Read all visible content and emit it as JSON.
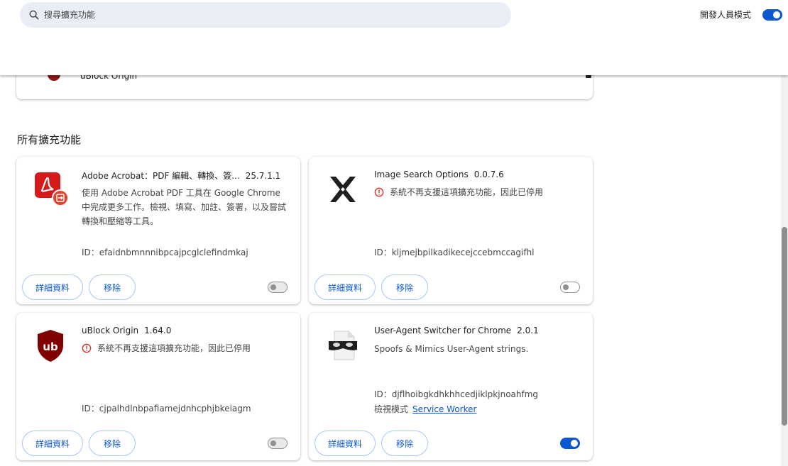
{
  "search": {
    "placeholder": "搜尋擴充功能"
  },
  "devmode": {
    "label": "開發人員模式",
    "enabled": true
  },
  "pinned": {
    "name": "uBlock Origin"
  },
  "section": {
    "title": "所有擴充功能"
  },
  "buttons": {
    "details": "詳細資料",
    "remove": "移除"
  },
  "extensions": [
    {
      "name": "Adobe Acrobat：PDF 編輯、轉換、簽...",
      "version": "25.7.1.1",
      "description": "使用 Adobe Acrobat PDF 工具在 Google Chrome 中完成更多工作。檢視、填寫、加註、簽署，以及嘗試轉換和壓縮等工具。",
      "id": "ID：efaidnbmnnnibpcajpcglclefindmkaj",
      "enabled": false,
      "icon": "adobe-acrobat-icon"
    },
    {
      "name": "Image Search Options",
      "version": "0.0.7.6",
      "warning": "系統不再支援這項擴充功能，因此已停用",
      "id": "ID：kljmejbpilkadikecejccebmccagifhl",
      "enabled": false,
      "icon": "image-search-options-icon"
    },
    {
      "name": "uBlock Origin",
      "version": "1.64.0",
      "warning": "系統不再支援這項擴充功能，因此已停用",
      "id": "ID：cjpalhdlnbpafiamejdnhcphjbkeiagm",
      "enabled": false,
      "icon": "ublock-origin-icon"
    },
    {
      "name": "User-Agent Switcher for Chrome",
      "version": "2.0.1",
      "description": "Spoofs & Mimics User-Agent strings.",
      "id": "ID：djflhoibgkdhkhhcedjiklpkjnoahfmg",
      "inspect_label": "檢視模式",
      "inspect_link": "Service Worker",
      "enabled": true,
      "icon": "user-agent-switcher-icon"
    }
  ],
  "colors": {
    "accent": "#0b57d0",
    "warning": "#d93025"
  }
}
